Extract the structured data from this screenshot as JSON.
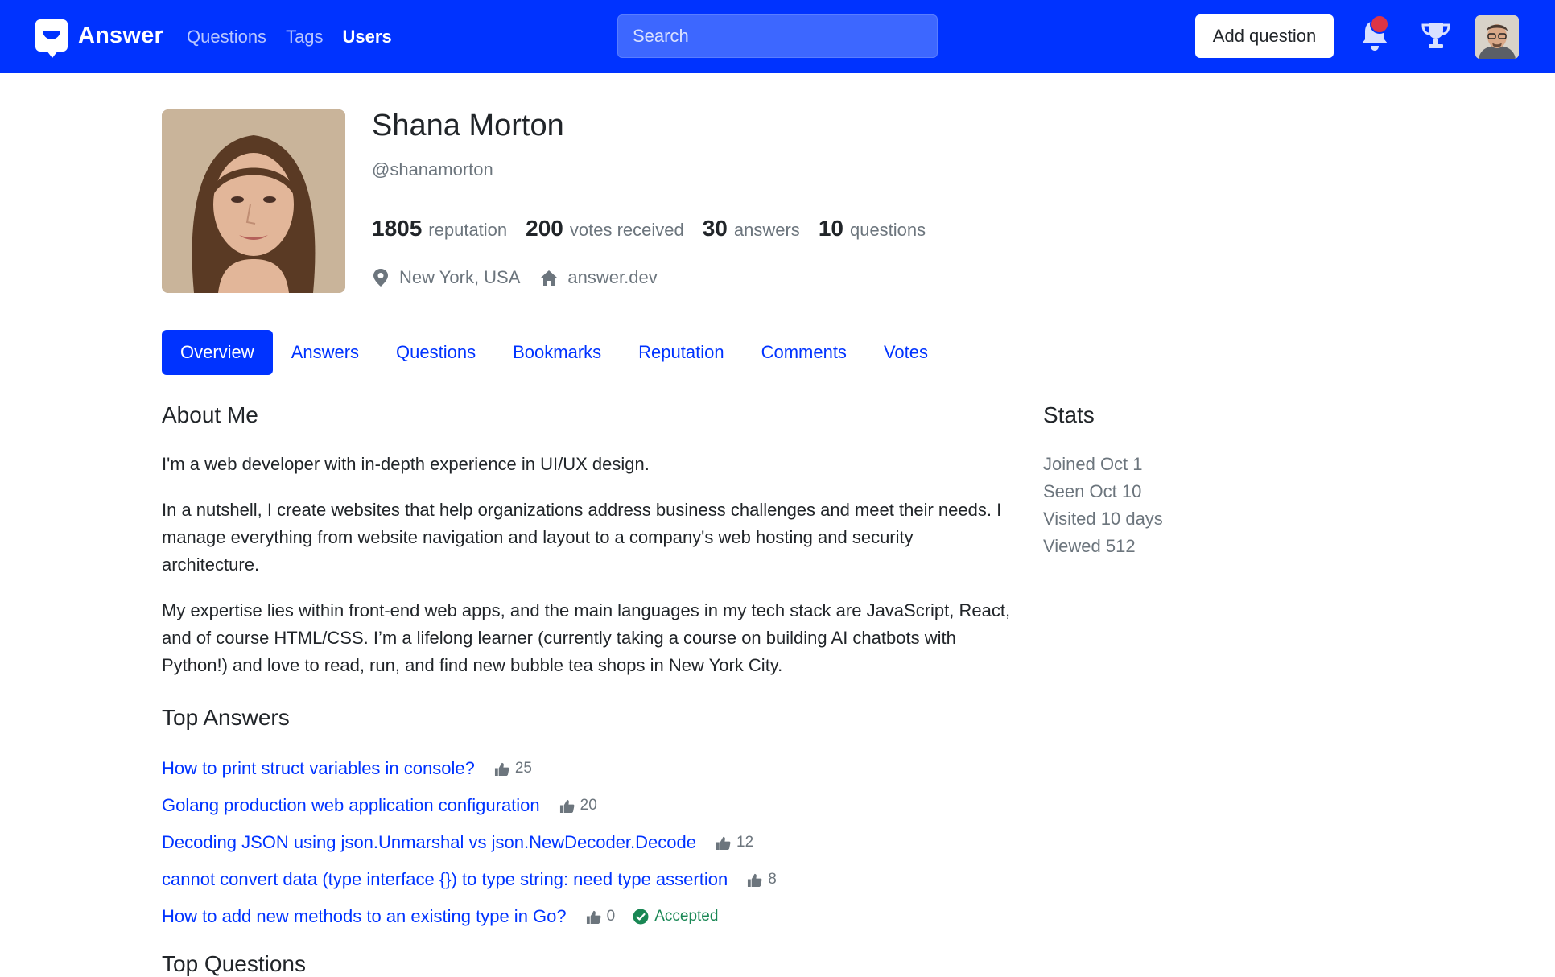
{
  "header": {
    "brand": "Answer",
    "nav": [
      "Questions",
      "Tags",
      "Users"
    ],
    "active_nav": "Users",
    "search_placeholder": "Search",
    "add_question_label": "Add question",
    "brand_color": "#0033ff",
    "notification_dot_color": "#dc3545"
  },
  "profile": {
    "name": "Shana Morton",
    "handle": "@shanamorton",
    "stats": [
      {
        "value": "1805",
        "label": "reputation"
      },
      {
        "value": "200",
        "label": "votes received"
      },
      {
        "value": "30",
        "label": "answers"
      },
      {
        "value": "10",
        "label": "questions"
      }
    ],
    "location": "New York, USA",
    "website": "answer.dev"
  },
  "tabs": [
    "Overview",
    "Answers",
    "Questions",
    "Bookmarks",
    "Reputation",
    "Comments",
    "Votes"
  ],
  "active_tab": "Overview",
  "about": {
    "heading": "About Me",
    "paragraphs": [
      "I'm a web developer with in-depth experience in UI/UX design.",
      "In a nutshell, I create websites that help organizations address business challenges and meet their needs. I manage everything from website navigation and layout to a company's web hosting and security architecture.",
      "My expertise lies within front-end web apps, and the main languages in my tech stack are JavaScript, React, and of course HTML/CSS. I’m a lifelong learner (currently taking a course on building AI chatbots with Python!) and love to read, run, and find new bubble tea shops in New York City."
    ]
  },
  "stats_panel": {
    "heading": "Stats",
    "items": [
      "Joined Oct 1",
      "Seen Oct 10",
      "Visited 10 days",
      "Viewed 512"
    ]
  },
  "top_answers": {
    "heading": "Top Answers",
    "items": [
      {
        "title": "How to print struct variables in console?",
        "votes": "25",
        "accepted": false
      },
      {
        "title": "Golang production web application configuration",
        "votes": "20",
        "accepted": false
      },
      {
        "title": "Decoding JSON using json.Unmarshal vs json.NewDecoder.Decode",
        "votes": "12",
        "accepted": false
      },
      {
        "title": "cannot convert data (type interface {}) to type string: need type assertion",
        "votes": "8",
        "accepted": false
      },
      {
        "title": "How to add new methods to an existing type in Go?",
        "votes": "0",
        "accepted": true
      }
    ],
    "accepted_label": "Accepted"
  },
  "top_questions": {
    "heading": "Top Questions"
  }
}
